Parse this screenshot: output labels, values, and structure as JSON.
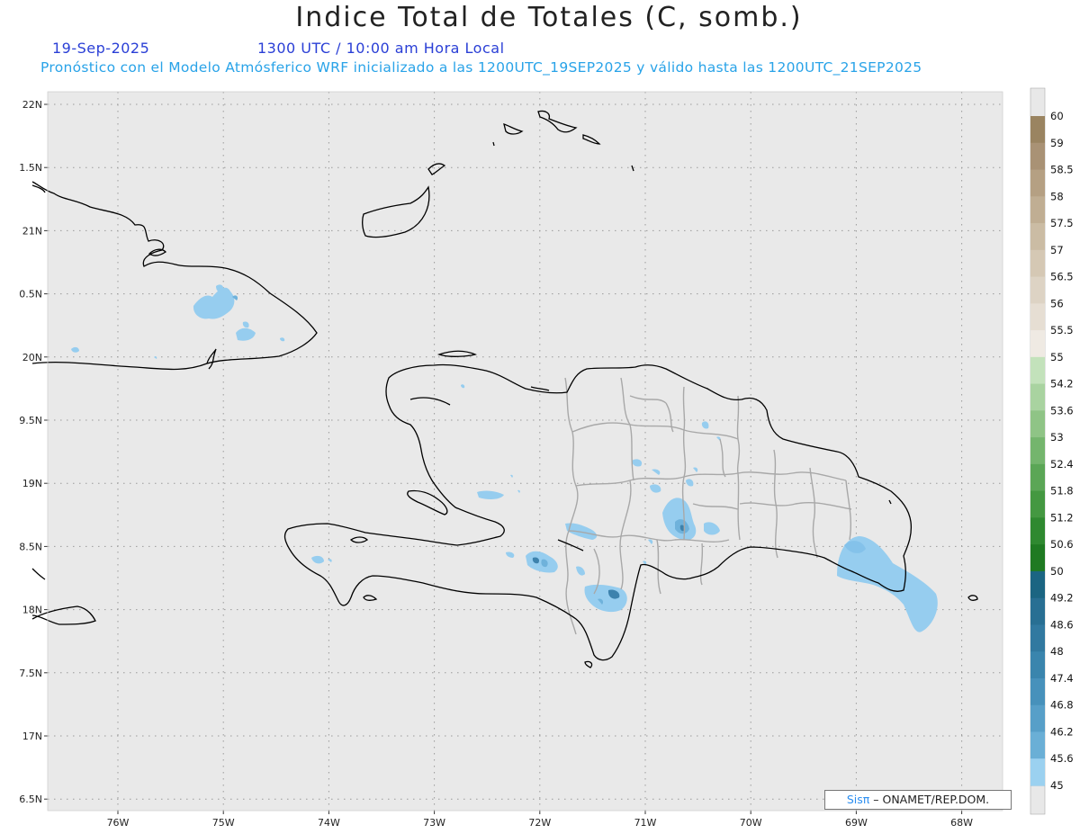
{
  "header": {
    "title": "Indice Total de Totales (C, somb.)",
    "date": "19-Sep-2025",
    "time": "1300 UTC / 10:00 am Hora Local",
    "description": "Pronóstico con el Modelo Atmósferico WRF inicializado a las 1200UTC_19SEP2025 y válido hasta las  1200UTC_21SEP2025"
  },
  "axes": {
    "lat_labels": [
      "22N",
      "1.5N",
      "21N",
      "0.5N",
      "20N",
      "9.5N",
      "19N",
      "8.5N",
      "18N",
      "7.5N",
      "17N",
      "6.5N"
    ],
    "lon_labels": [
      "76W",
      "75W",
      "74W",
      "73W",
      "72W",
      "71W",
      "70W",
      "69W",
      "68W"
    ]
  },
  "colorbar": {
    "levels": [
      "60",
      "59",
      "58.5",
      "58",
      "57.5",
      "57",
      "56.5",
      "56",
      "55.5",
      "55",
      "54.2",
      "53.6",
      "53",
      "52.4",
      "51.8",
      "51.2",
      "50.6",
      "50",
      "49.2",
      "48.6",
      "48",
      "47.4",
      "46.8",
      "46.2",
      "45.6",
      "45"
    ],
    "colors": [
      "#9a8461",
      "#a99275",
      "#b5a083",
      "#c0ae93",
      "#cbbca4",
      "#d5c8b4",
      "#ddd3c4",
      "#e6ded3",
      "#efeae3",
      "#c3e2bb",
      "#a9d3a0",
      "#8fc486",
      "#74b56d",
      "#5ba656",
      "#449841",
      "#2f8930",
      "#1f7a22",
      "#1b6582",
      "#286f93",
      "#3179a0",
      "#3a85ad",
      "#4791bb",
      "#579fc8",
      "#6aafd6",
      "#80bfe3",
      "#9bd1f0"
    ],
    "zero_color": "#e8e8e8"
  },
  "colors": {
    "map_background": "#e9e9e9",
    "coastline": "#000000",
    "province_border": "#a8a8a8",
    "shade_light": "#96cdef",
    "shade_mid": "#6fb2db",
    "shade_dark": "#3d82ad"
  },
  "credit": {
    "brand": "Sisπ",
    "text": " – ONAMET/REP.DOM."
  }
}
